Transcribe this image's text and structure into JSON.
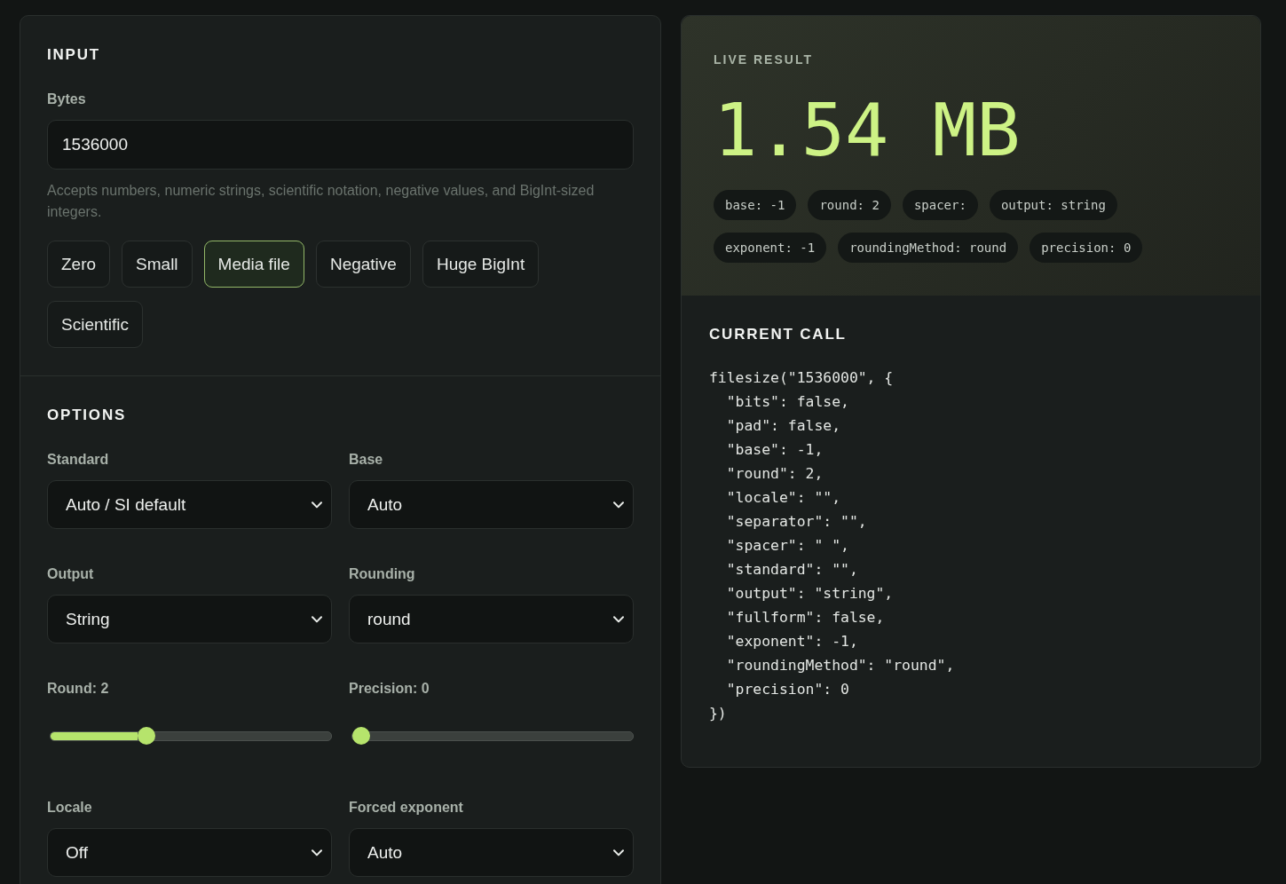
{
  "input_panel": {
    "heading": "INPUT",
    "bytes_field": {
      "label": "Bytes",
      "value": "1536000"
    },
    "help_text": "Accepts numbers, numeric strings, scientific notation, negative values, and BigInt-sized integers.",
    "presets": [
      {
        "label": "Zero",
        "selected": false
      },
      {
        "label": "Small",
        "selected": false
      },
      {
        "label": "Media file",
        "selected": true
      },
      {
        "label": "Negative",
        "selected": false
      },
      {
        "label": "Huge BigInt",
        "selected": false
      },
      {
        "label": "Scientific",
        "selected": false
      }
    ]
  },
  "options_panel": {
    "heading": "OPTIONS",
    "fields": [
      {
        "kind": "select",
        "label": "Standard",
        "value": "Auto / SI default"
      },
      {
        "kind": "select",
        "label": "Base",
        "value": "Auto"
      },
      {
        "kind": "select",
        "label": "Output",
        "value": "String"
      },
      {
        "kind": "select",
        "label": "Rounding",
        "value": "round"
      },
      {
        "kind": "slider",
        "label": "Round: 2",
        "level": 0.33
      },
      {
        "kind": "slider",
        "label": "Precision: 0",
        "level": 0
      },
      {
        "kind": "select",
        "label": "Locale",
        "value": "Off"
      },
      {
        "kind": "select",
        "label": "Forced exponent",
        "value": "Auto"
      }
    ]
  },
  "live_result": {
    "heading": "LIVE RESULT",
    "value": "1.54 MB",
    "chips": [
      "base: -1",
      "round: 2",
      "spacer:",
      "output: string",
      "exponent: -1",
      "roundingMethod: round",
      "precision: 0"
    ]
  },
  "current_call": {
    "heading": "CURRENT CALL",
    "code_lines": [
      "filesize(\"1536000\", {",
      "  \"bits\": false,",
      "  \"pad\": false,",
      "  \"base\": -1,",
      "  \"round\": 2,",
      "  \"locale\": \"\",",
      "  \"separator\": \"\",",
      "  \"spacer\": \" \",",
      "  \"standard\": \"\",",
      "  \"output\": \"string\",",
      "  \"fullform\": false,",
      "  \"exponent\": -1,",
      "  \"roundingMethod\": \"round\",",
      "  \"precision\": 0",
      "})"
    ]
  }
}
